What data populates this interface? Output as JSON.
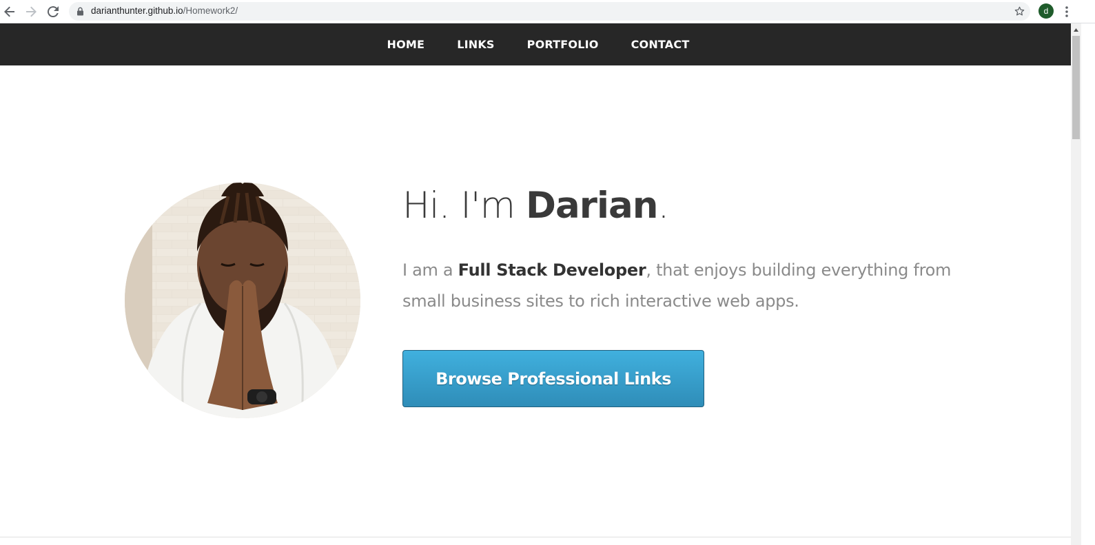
{
  "browser": {
    "url_host": "darianthunter.github.io",
    "url_path": "/Homework2/",
    "profile_initial": "d"
  },
  "nav": {
    "items": [
      {
        "label": "HOME"
      },
      {
        "label": "LINKS"
      },
      {
        "label": "PORTFOLIO"
      },
      {
        "label": "CONTACT"
      }
    ]
  },
  "hero": {
    "greeting_prefix": "Hi. I'm ",
    "name": "Darian",
    "greeting_suffix": ".",
    "tagline_prefix": "I am a ",
    "tagline_role": "Full Stack Developer",
    "tagline_suffix": ", that enjoys building everything from small business sites to rich interactive web apps.",
    "cta_label": "Browse Professional Links"
  },
  "colors": {
    "nav_background": "#272727",
    "cta_blue": "#3a9fcc",
    "avatar_green": "#1f5c2b"
  },
  "icons": {
    "back": "arrow-left-icon",
    "forward": "arrow-right-icon",
    "reload": "reload-icon",
    "lock": "lock-icon",
    "bookmark": "star-icon",
    "menu": "kebab-menu-icon"
  }
}
